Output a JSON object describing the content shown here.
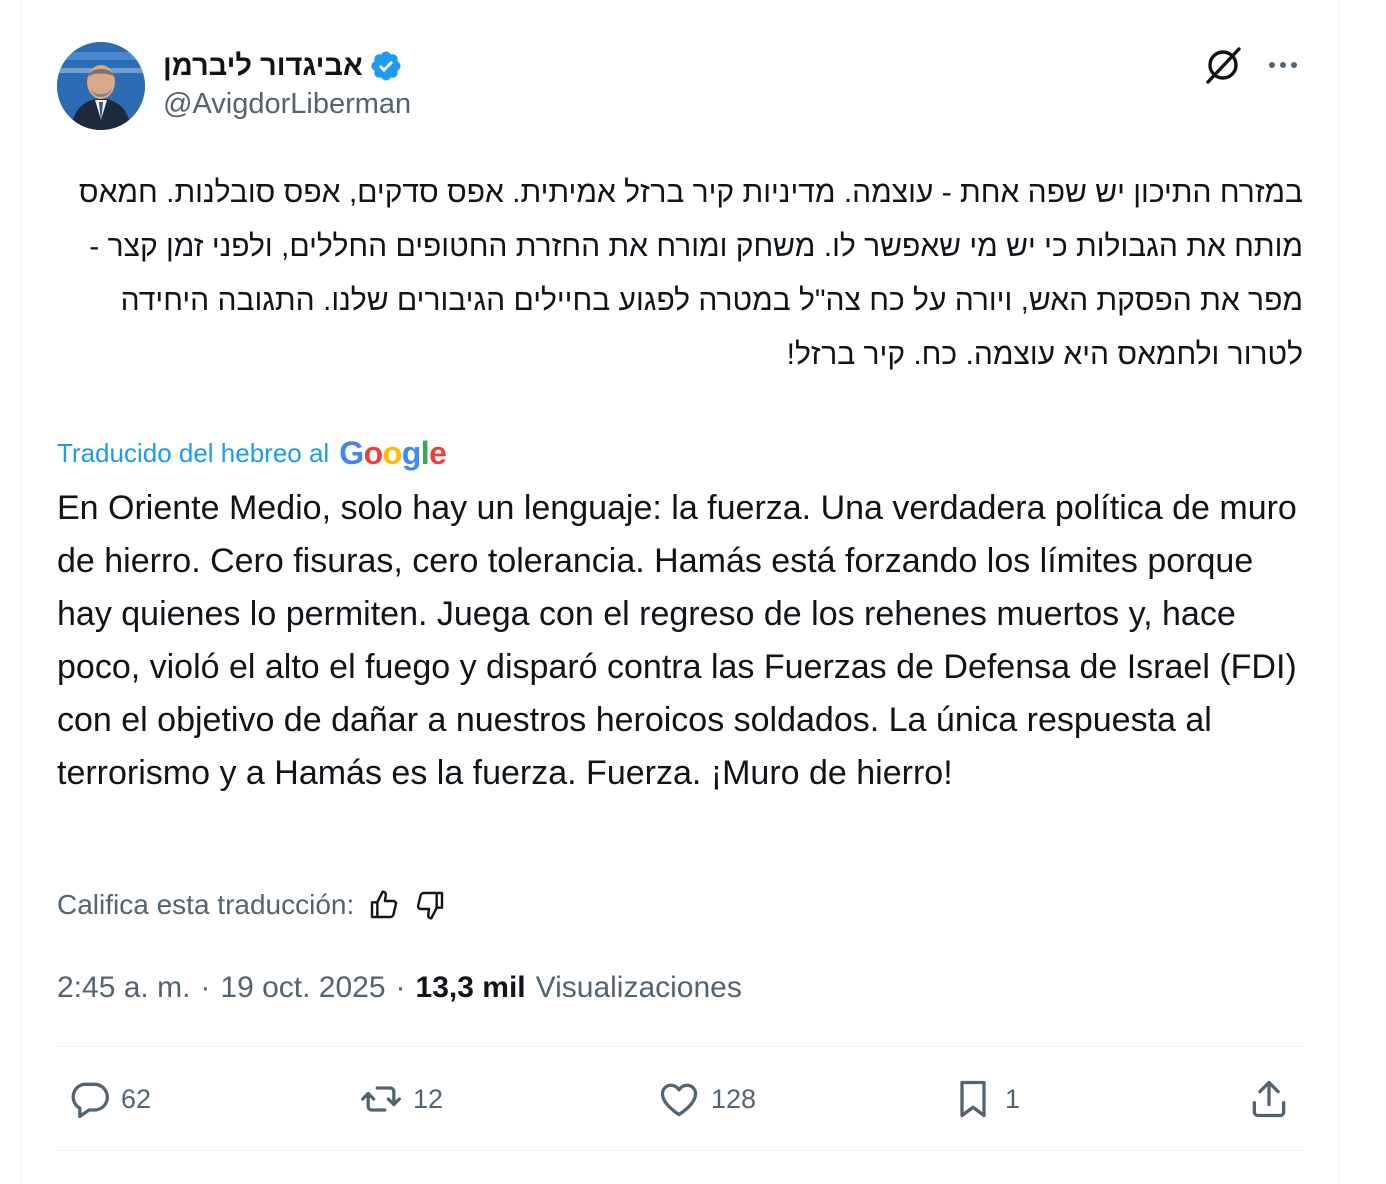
{
  "author": {
    "display_name": "אביגדור ליברמן",
    "handle": "@AvigdorLiberman",
    "verified_icon": "verified-badge-icon",
    "verified_color": "#1d9bf0"
  },
  "tweet": {
    "original_text": "במזרח התיכון יש שפה אחת - עוצמה. מדיניות קיר ברזל אמיתית. אפס סדקים, אפס סובלנות. חמאס מותח את הגבולות כי יש מי שאפשר לו. משחק ומורח את החזרת החטופים החללים, ולפני זמן קצר - מפר את הפסקת האש, ויורה על כח צה\"ל במטרה לפגוע בחיילים הגיבורים שלנו. התגובה היחידה לטרור ולחמאס היא עוצמה. כח. קיר ברזל!",
    "translation_label": "Traducido del hebreo al",
    "translation_provider": "Google",
    "translated_text": "En Oriente Medio, solo hay un lenguaje: la fuerza. Una verdadera política de muro de hierro. Cero fisuras, cero tolerancia. Hamás está forzando los límites porque hay quienes lo permiten. Juega con el regreso de los rehenes muertos y, hace poco, violó el alto el fuego y disparó contra las Fuerzas de Defensa de Israel (FDI) con el objetivo de dañar a nuestros heroicos soldados. La única respuesta al terrorismo y a Hamás es la fuerza. Fuerza. ¡Muro de hierro!",
    "rate_label": "Califica esta traducción:",
    "time": "2:45 a. m.",
    "separator": "·",
    "date": "19 oct. 2025",
    "views_count": "13,3 mil",
    "views_label": "Visualizaciones"
  },
  "actions": {
    "replies": "62",
    "reposts": "12",
    "likes": "128",
    "bookmarks": "1"
  },
  "colors": {
    "accent": "#1d9bf0",
    "text_primary": "#0f1419",
    "text_secondary": "#536471",
    "divider": "#eff3f4"
  }
}
